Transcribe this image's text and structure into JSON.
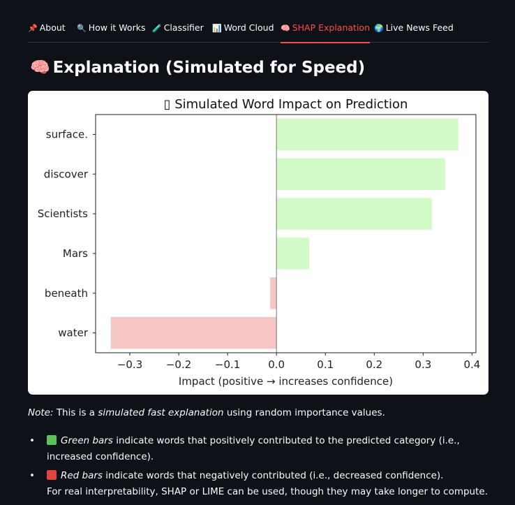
{
  "tabs": [
    {
      "label": "About",
      "icon": "pin-icon",
      "glyph": "📌",
      "active": false
    },
    {
      "label": "How it Works",
      "icon": "magnifier-icon",
      "glyph": "🔍",
      "active": false
    },
    {
      "label": "Classifier",
      "icon": "pencil-icon",
      "glyph": "🧪",
      "active": false
    },
    {
      "label": "Word Cloud",
      "icon": "bar-chart-icon",
      "glyph": "📊",
      "active": false
    },
    {
      "label": "SHAP Explanation",
      "icon": "brain-icon",
      "glyph": "🧠",
      "active": true
    },
    {
      "label": "Live News Feed",
      "icon": "globe-icon",
      "glyph": "🌍",
      "active": false
    }
  ],
  "heading": {
    "icon": "brain-icon",
    "glyph": "🧠",
    "text": "Explanation (Simulated for Speed)"
  },
  "chart_data": {
    "type": "bar",
    "orientation": "horizontal",
    "title": "▯ Simulated Word Impact on Prediction",
    "xlabel": "Impact (positive → increases confidence)",
    "ylabel": "",
    "categories": [
      "surface.",
      "discover",
      "Scientists",
      "Mars",
      "beneath",
      "water"
    ],
    "values": [
      0.372,
      0.345,
      0.318,
      0.067,
      -0.013,
      -0.339
    ],
    "xlim": [
      -0.37,
      0.408
    ],
    "xticks": [
      -0.3,
      -0.2,
      -0.1,
      0.0,
      0.1,
      0.2,
      0.3,
      0.4
    ],
    "xtick_labels": [
      "−0.3",
      "−0.2",
      "−0.1",
      "0.0",
      "0.1",
      "0.2",
      "0.3",
      "0.4"
    ],
    "positive_color": "#d2fbc8",
    "negative_color": "#f5c6c4",
    "grid": false
  },
  "note": {
    "lead": "Note:",
    "text1": "This is a",
    "emph": "simulated fast explanation",
    "text2": "using random importance values."
  },
  "bullets": [
    {
      "square_color": "#5cc25c",
      "emph": "Green bars",
      "text": "indicate words that positively contributed to the predicted category (i.e., increased confidence)."
    },
    {
      "square_color": "#e0443c",
      "emph": "Red bars",
      "text": "indicate words that negatively contributed (i.e., decreased confidence).",
      "extra": "For real interpretability, SHAP or LIME can be used, though they may take longer to compute."
    }
  ],
  "bullet_glyph": "•"
}
